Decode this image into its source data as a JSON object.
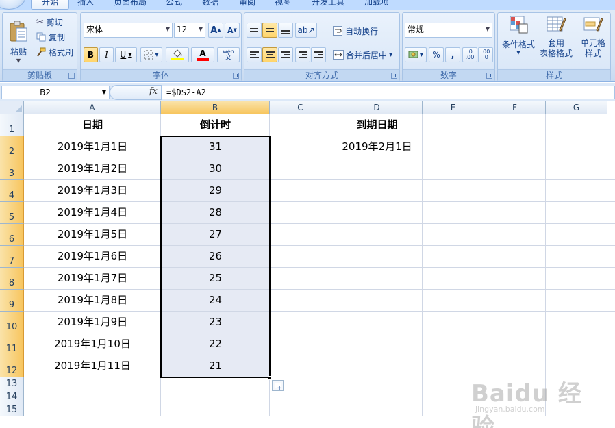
{
  "ribbon": {
    "tabs": [
      {
        "label": "开始",
        "active": true
      },
      {
        "label": "插入",
        "active": false
      },
      {
        "label": "页面布局",
        "active": false
      },
      {
        "label": "公式",
        "active": false
      },
      {
        "label": "数据",
        "active": false
      },
      {
        "label": "审阅",
        "active": false
      },
      {
        "label": "视图",
        "active": false
      },
      {
        "label": "开发工具",
        "active": false
      },
      {
        "label": "加载项",
        "active": false
      }
    ],
    "clipboard": {
      "paste_label": "粘贴",
      "cut_label": "剪切",
      "copy_label": "复制",
      "format_painter_label": "格式刷",
      "group_label": "剪贴板"
    },
    "font": {
      "font_name": "宋体",
      "font_size": "12",
      "grow_label": "A",
      "shrink_label": "A",
      "bold_label": "B",
      "italic_label": "I",
      "underline_label": "U",
      "font_color_label": "A",
      "phonetic_label": "wén",
      "phonetic_sub": "文",
      "group_label": "字体",
      "fill_color": "#ffff00",
      "font_color": "#ff0000"
    },
    "alignment": {
      "wrap_text_label": "自动换行",
      "merge_center_label": "合并后居中",
      "group_label": "对齐方式"
    },
    "number": {
      "format_value": "常规",
      "percent_label": "%",
      "comma_label": ",",
      "increase_decimal_label": ".0 .00",
      "decrease_decimal_label": ".00 .0",
      "group_label": "数字"
    },
    "styles": {
      "conditional_format_label": "条件格式",
      "table_format_label_1": "套用",
      "table_format_label_2": "表格格式",
      "cell_styles_label_1": "单元格",
      "cell_styles_label_2": "样式",
      "group_label": "样式"
    }
  },
  "formula_bar": {
    "name_box": "B2",
    "fx_label": "fx",
    "formula": "=$D$2-A2"
  },
  "sheet": {
    "columns": [
      "A",
      "B",
      "C",
      "D",
      "E",
      "F",
      "G"
    ],
    "selected_column": "B",
    "rows": [
      "1",
      "2",
      "3",
      "4",
      "5",
      "6",
      "7",
      "8",
      "9",
      "10",
      "11",
      "12",
      "13",
      "14",
      "15"
    ],
    "selected_rows": [
      "2",
      "3",
      "4",
      "5",
      "6",
      "7",
      "8",
      "9",
      "10",
      "11",
      "12"
    ],
    "header_date": "日期",
    "header_countdown": "倒计时",
    "header_due": "到期日期",
    "due_date": "2019年2月1日",
    "dates": [
      "2019年1月1日",
      "2019年1月2日",
      "2019年1月3日",
      "2019年1月4日",
      "2019年1月5日",
      "2019年1月6日",
      "2019年1月7日",
      "2019年1月8日",
      "2019年1月9日",
      "2019年1月10日",
      "2019年1月11日"
    ],
    "countdowns": [
      "31",
      "30",
      "29",
      "28",
      "27",
      "26",
      "25",
      "24",
      "23",
      "22",
      "21"
    ]
  },
  "watermark": {
    "main": "Baidu 经验",
    "sub": "jingyan.baidu.com"
  }
}
